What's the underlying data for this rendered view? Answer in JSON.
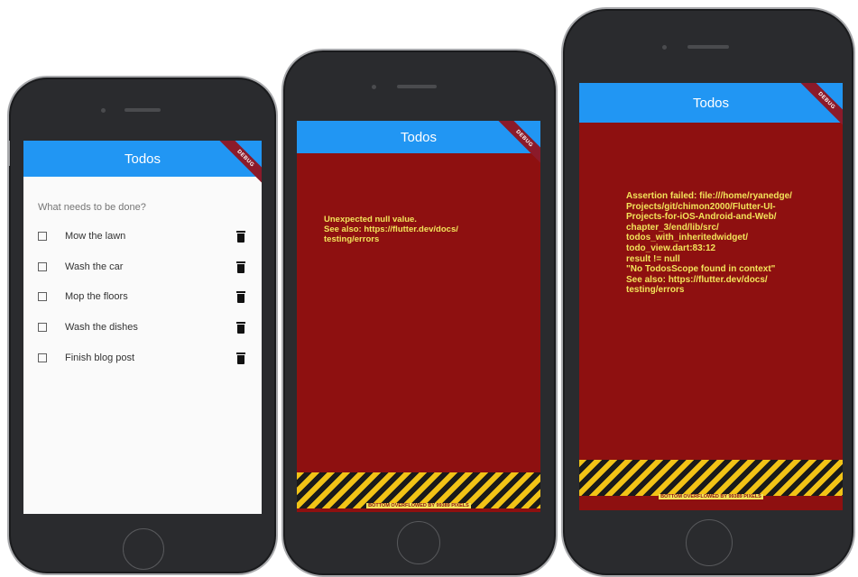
{
  "phones": [
    {
      "appbar_title": "Todos",
      "debug_banner": "DEBUG",
      "hint": "What needs to be done?",
      "todos": [
        {
          "label": "Mow the lawn",
          "checked": false
        },
        {
          "label": "Wash the car",
          "checked": false
        },
        {
          "label": "Mop the floors",
          "checked": false
        },
        {
          "label": "Wash the dishes",
          "checked": false
        },
        {
          "label": "Finish blog post",
          "checked": false
        }
      ]
    },
    {
      "appbar_title": "Todos",
      "debug_banner": "DEBUG",
      "error_text": "Unexpected null value.\nSee also: https://flutter.dev/docs/\ntesting/errors",
      "overflow_text": "BOTTOM OVERFLOWED BY 99389 PIXELS"
    },
    {
      "appbar_title": "Todos",
      "debug_banner": "DEBUG",
      "error_text": "Assertion failed: file:///home/ryanedge/\nProjects/git/chimon2000/Flutter-UI-\nProjects-for-iOS-Android-and-Web/\nchapter_3/end/lib/src/\ntodos_with_inheritedwidget/\ntodo_view.dart:83:12\nresult != null\n\"No TodosScope found in context\"\nSee also: https://flutter.dev/docs/\ntesting/errors",
      "overflow_text": "BOTTOM OVERFLOWED BY 99389 PIXELS"
    }
  ],
  "colors": {
    "appbar": "#2196f3",
    "error_background": "#8e1010",
    "error_text": "#f3e45a",
    "stripe_yellow": "#f2c316",
    "device_body": "#2a2b2e"
  },
  "icons": [
    "checkbox-icon",
    "trash-icon",
    "home-button"
  ]
}
